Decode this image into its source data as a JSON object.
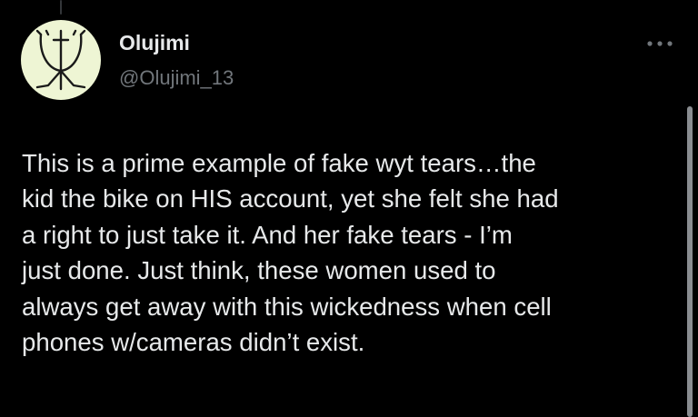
{
  "author": {
    "display_name": "Olujimi",
    "handle": "@Olujimi_13",
    "avatar_icon": "trident-symbol-avatar",
    "avatar_bg": "#eef5d4"
  },
  "actions": {
    "more_icon": "more-horizontal-icon"
  },
  "tweet": {
    "lines": [
      "This is a prime example of fake wyt tears…the",
      "kid the bike on HIS account, yet she felt she had",
      "a right to just take it.  And her fake tears - I’m",
      "just done. Just think, these women used to",
      "always get away with this wickedness when cell",
      "phones w/cameras didn’t exist."
    ]
  },
  "colors": {
    "background": "#000000",
    "primary_text": "#e7e9ea",
    "secondary_text": "#71767b"
  }
}
